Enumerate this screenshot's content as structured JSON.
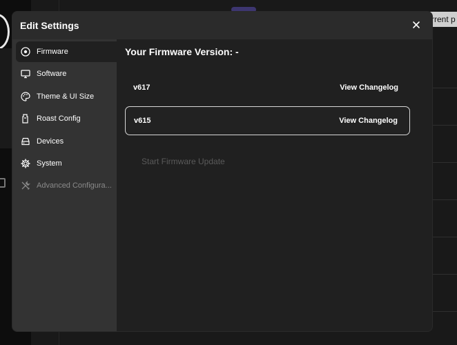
{
  "background": {
    "tab_text": "rrent p"
  },
  "modal": {
    "title": "Edit Settings",
    "close_icon": "close-icon"
  },
  "sidebar": {
    "items": [
      {
        "label": "Firmware",
        "icon": "target-icon",
        "active": true
      },
      {
        "label": "Software",
        "icon": "monitor-icon"
      },
      {
        "label": "Theme & UI Size",
        "icon": "palette-icon"
      },
      {
        "label": "Roast Config",
        "icon": "roaster-icon"
      },
      {
        "label": "Devices",
        "icon": "drive-icon"
      },
      {
        "label": "System",
        "icon": "gear-icon"
      },
      {
        "label": "Advanced Configura...",
        "icon": "wrench-screwdriver-icon",
        "disabled": true
      }
    ]
  },
  "content": {
    "firmware_title": "Your Firmware Version: -",
    "versions": [
      {
        "version": "v617",
        "link": "View Changelog",
        "selected": false
      },
      {
        "version": "v615",
        "link": "View Changelog",
        "selected": true
      }
    ],
    "update_button": "Start Firmware Update"
  },
  "colors": {
    "modal_bg": "#202020",
    "sidebar_bg": "#333333",
    "header_bg": "#2b2b2b",
    "selected_border": "#d8d8d8",
    "disabled_text": "#5a5a5a"
  }
}
